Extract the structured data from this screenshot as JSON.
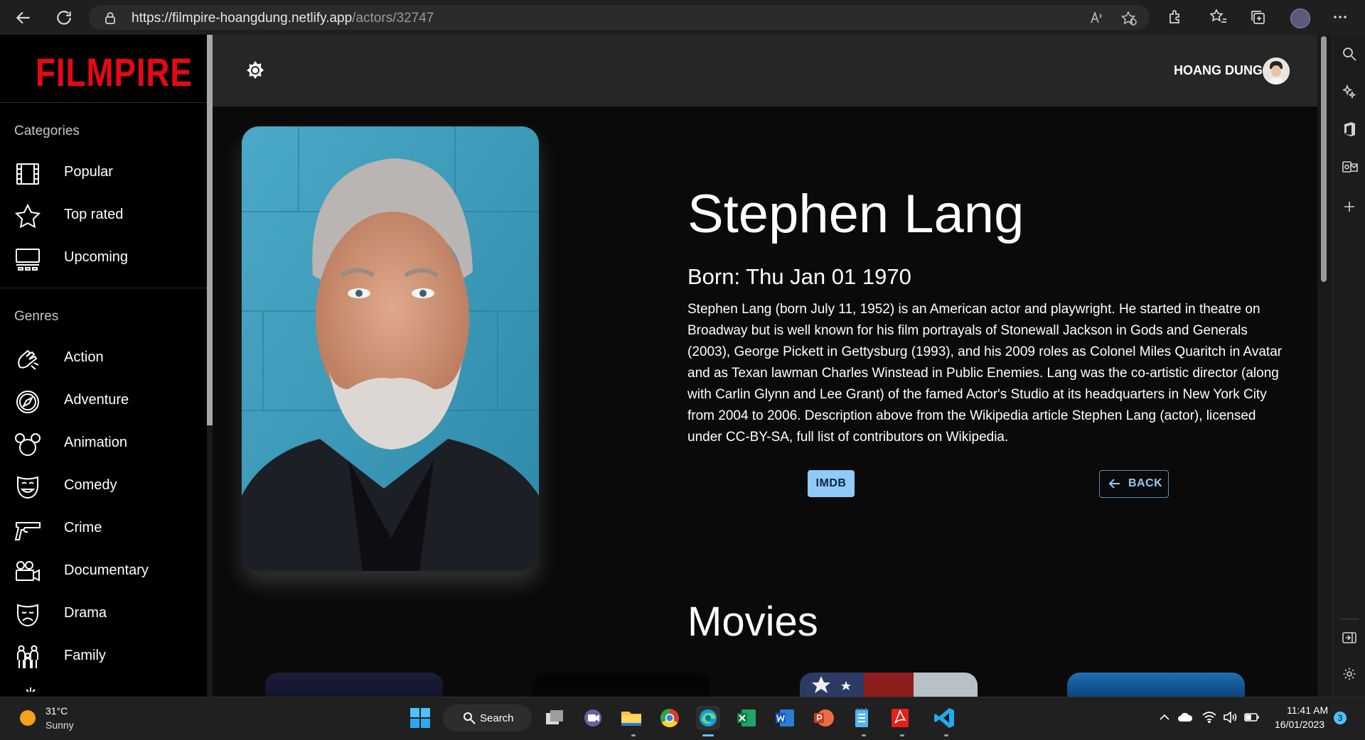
{
  "browser": {
    "url_domain": "https://filmpire-hoangdung.netlify.app",
    "url_path": "/actors/32747"
  },
  "app": {
    "logo": "FILMPIRE",
    "user_name": "HOANG DUNG",
    "categories_title": "Categories",
    "categories": [
      {
        "label": "Popular",
        "icon": "film-icon"
      },
      {
        "label": "Top rated",
        "icon": "star-icon"
      },
      {
        "label": "Upcoming",
        "icon": "theater-icon"
      }
    ],
    "genres_title": "Genres",
    "genres": [
      {
        "label": "Action",
        "icon": "action-icon"
      },
      {
        "label": "Adventure",
        "icon": "compass-icon"
      },
      {
        "label": "Animation",
        "icon": "mouse-ears-icon"
      },
      {
        "label": "Comedy",
        "icon": "comedy-mask-icon"
      },
      {
        "label": "Crime",
        "icon": "gun-icon"
      },
      {
        "label": "Documentary",
        "icon": "camera-icon"
      },
      {
        "label": "Drama",
        "icon": "drama-mask-icon"
      },
      {
        "label": "Family",
        "icon": "family-icon"
      }
    ]
  },
  "actor": {
    "name": "Stephen Lang",
    "born": "Born: Thu Jan 01 1970",
    "bio": "Stephen Lang (born July 11, 1952) is an American actor and playwright. He started in theatre on Broadway but is well known for his film portrayals of Stonewall Jackson in Gods and Generals (2003), George Pickett in Gettysburg (1993), and his 2009 roles as Colonel Miles Quaritch in Avatar and as Texan lawman Charles Winstead in Public Enemies. Lang was the co-artistic director (along with Carlin Glynn and Lee Grant) of the famed Actor's Studio at its headquarters in New York City from 2004 to 2006. Description above from the Wikipedia article Stephen Lang (actor), licensed under CC-BY-SA, full list of contributors on Wikipedia.",
    "imdb_label": "IMDB",
    "back_label": "BACK"
  },
  "movies_title": "Movies",
  "taskbar": {
    "temperature": "31°C",
    "condition": "Sunny",
    "search_label": "Search",
    "time": "11:41 AM",
    "date": "16/01/2023",
    "notifications": "3"
  },
  "colors": {
    "brand": "#e50914",
    "accent": "#90caf9",
    "fab": "#1aa0f0"
  }
}
